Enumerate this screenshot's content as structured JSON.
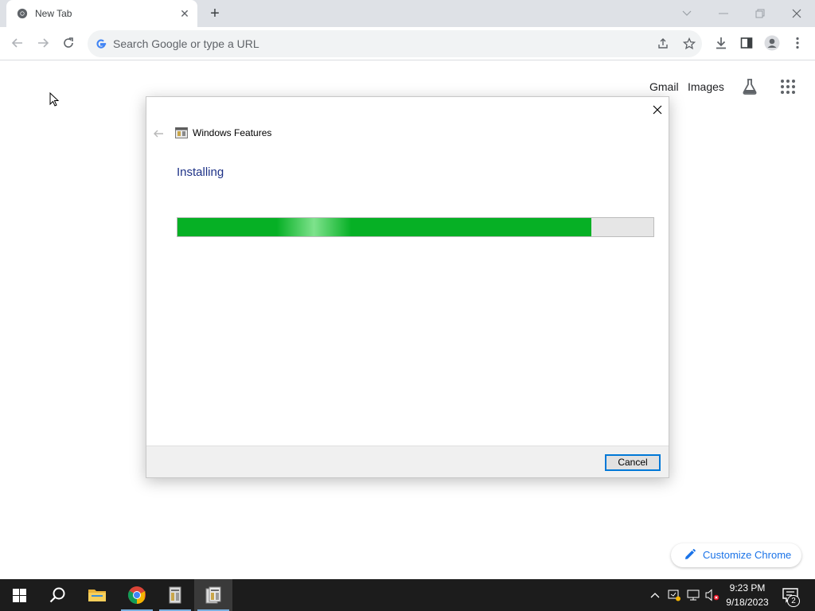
{
  "browser": {
    "tab_title": "New Tab",
    "omnibox_placeholder": "Search Google or type a URL"
  },
  "ntp": {
    "gmail_label": "Gmail",
    "images_label": "Images",
    "customize_label": "Customize Chrome"
  },
  "dialog": {
    "window_title": "Windows Features",
    "heading": "Installing",
    "progress_fraction": 0.87,
    "cancel_label": "Cancel"
  },
  "taskbar": {
    "time": "9:23 PM",
    "date": "9/18/2023",
    "notification_count": "2",
    "apps": [
      "start-icon",
      "search-icon",
      "file-explorer-icon",
      "chrome-icon",
      "windows-features-icon",
      "windows-features-icon"
    ]
  },
  "colors": {
    "progress_green": "#06b025",
    "heading_blue": "#1e3287",
    "accent_blue": "#1a73e8"
  }
}
